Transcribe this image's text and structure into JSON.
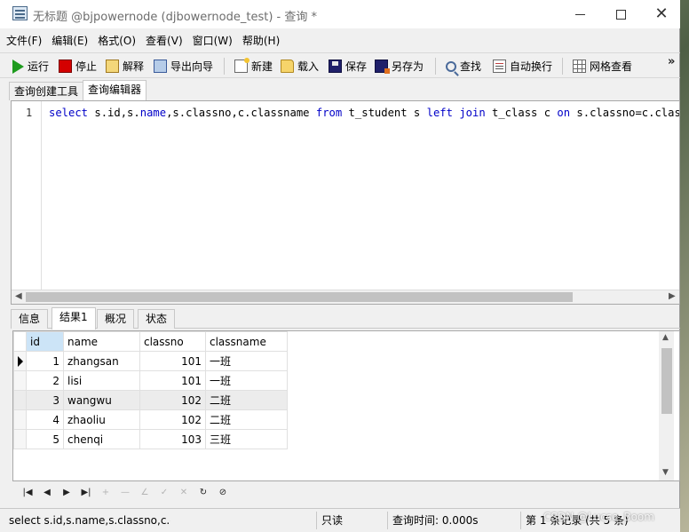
{
  "window": {
    "title": "无标题 @bjpowernode (djbowernode_test) - 查询 *",
    "minimize": "",
    "maximize": "",
    "close": "✕"
  },
  "menu": [
    "文件(F)",
    "编辑(E)",
    "格式(O)",
    "查看(V)",
    "窗口(W)",
    "帮助(H)"
  ],
  "toolbar": {
    "run": "运行",
    "stop": "停止",
    "explain": "解释",
    "export_wizard": "导出向导",
    "new": "新建",
    "load": "载入",
    "save": "保存",
    "save_as": "另存为",
    "find": "查找",
    "word_wrap": "自动换行",
    "grid_view": "网格查看",
    "more": "»"
  },
  "query_tabs": [
    "查询创建工具",
    "查询编辑器"
  ],
  "editor": {
    "line_number": "1",
    "sql_tokens": [
      {
        "t": "select",
        "k": true
      },
      {
        "t": " s.id,s.",
        "k": false
      },
      {
        "t": "name",
        "k": true
      },
      {
        "t": ",s.classno,c.classname ",
        "k": false
      },
      {
        "t": "from",
        "k": true
      },
      {
        "t": " t_student s ",
        "k": false
      },
      {
        "t": "left",
        "k": true
      },
      {
        "t": " ",
        "k": false
      },
      {
        "t": "join",
        "k": true
      },
      {
        "t": " t_class c ",
        "k": false
      },
      {
        "t": "on",
        "k": true
      },
      {
        "t": " s.classno=c.classno;",
        "k": false
      }
    ],
    "keyword_color": "#0000c8"
  },
  "result_tabs": [
    "信息",
    "结果1",
    "概况",
    "状态"
  ],
  "result": {
    "columns": [
      "id",
      "name",
      "classno",
      "classname"
    ],
    "rows": [
      [
        "1",
        "zhangsan",
        "101",
        "一班"
      ],
      [
        "2",
        "lisi",
        "101",
        "一班"
      ],
      [
        "3",
        "wangwu",
        "102",
        "二班"
      ],
      [
        "4",
        "zhaoliu",
        "102",
        "二班"
      ],
      [
        "5",
        "chenqi",
        "103",
        "三班"
      ]
    ]
  },
  "nav_buttons": [
    {
      "icon": "first-record-icon",
      "glyph": "|◀"
    },
    {
      "icon": "prev-record-icon",
      "glyph": "◀"
    },
    {
      "icon": "next-record-icon",
      "glyph": "▶"
    },
    {
      "icon": "last-record-icon",
      "glyph": "▶|"
    },
    {
      "icon": "add-record-icon",
      "glyph": "+"
    },
    {
      "icon": "delete-record-icon",
      "glyph": "—"
    },
    {
      "icon": "edit-record-icon",
      "glyph": "∠"
    },
    {
      "icon": "apply-icon",
      "glyph": "✓"
    },
    {
      "icon": "cancel-icon",
      "glyph": "✕"
    },
    {
      "icon": "refresh-icon",
      "glyph": "↻"
    },
    {
      "icon": "stop-icon",
      "glyph": "⊘"
    }
  ],
  "status": {
    "sql": "select s.id,s.name,s.classno,c.cla",
    "mode": "只读",
    "query_time": "查询时间: 0.000s",
    "record": "第 1 条记录 (共 5 条)"
  },
  "watermark": "CSDN @Lucse_Boom"
}
